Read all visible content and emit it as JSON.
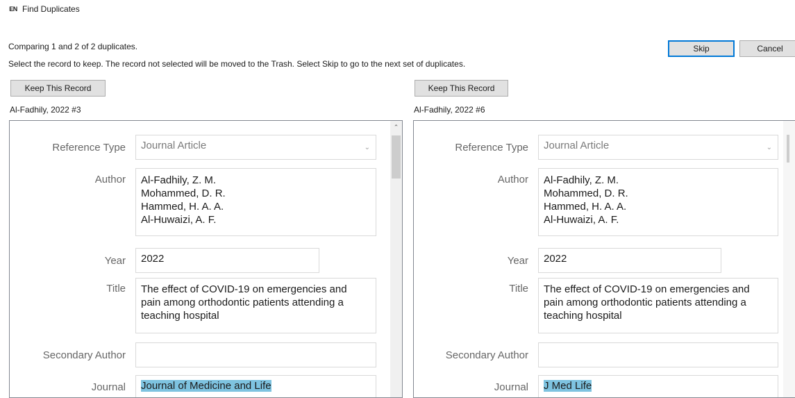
{
  "window": {
    "icon_text": "EN",
    "title": "Find Duplicates"
  },
  "status": {
    "comparing": "Comparing 1 and 2 of 2 duplicates.",
    "instructions": "Select the record to keep. The record not selected will be moved to the Trash. Select Skip to go to the next set of duplicates."
  },
  "buttons": {
    "skip": "Skip",
    "cancel": "Cancel",
    "keep_left": "Keep This Record",
    "keep_right": "Keep This Record"
  },
  "left": {
    "record_label": "Al-Fadhily, 2022 #3",
    "reference_type_label": "Reference Type",
    "reference_type_value": "Journal Article",
    "author_label": "Author",
    "authors": [
      "Al-Fadhily, Z. M.",
      "Mohammed, D. R.",
      "Hammed, H. A. A.",
      "Al-Huwaizi, A. F."
    ],
    "year_label": "Year",
    "year": "2022",
    "title_label": "Title",
    "title_lines": [
      "The effect of COVID-19 on emergencies and",
      "pain among orthodontic patients attending a",
      "teaching hospital"
    ],
    "secondary_author_label": "Secondary Author",
    "secondary_author": "",
    "journal_label": "Journal",
    "journal": "Journal of Medicine and Life"
  },
  "right": {
    "record_label": "Al-Fadhily, 2022 #6",
    "reference_type_label": "Reference Type",
    "reference_type_value": "Journal Article",
    "author_label": "Author",
    "authors": [
      "Al-Fadhily, Z. M.",
      "Mohammed, D. R.",
      "Hammed, H. A. A.",
      "Al-Huwaizi, A. F."
    ],
    "year_label": "Year",
    "year": "2022",
    "title_label": "Title",
    "title_lines": [
      "The effect of COVID-19 on emergencies and",
      "pain among orthodontic patients attending a",
      "teaching hospital"
    ],
    "secondary_author_label": "Secondary Author",
    "secondary_author": "",
    "journal_label": "Journal",
    "journal": "J Med Life"
  },
  "icons": {
    "scroll_up": "chevron-up-icon",
    "dropdown": "chevron-down-icon"
  },
  "colors": {
    "journal_highlight": "#7ec3e0",
    "default_button_border": "#0078d7"
  }
}
